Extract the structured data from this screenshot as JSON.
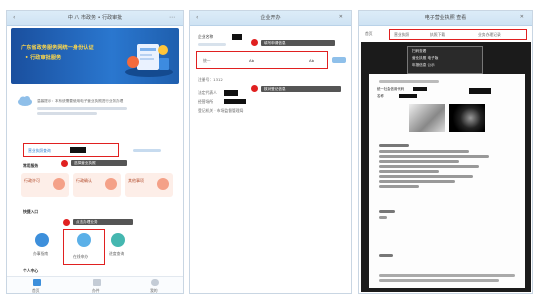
{
  "left_panel": {
    "title": "中 八 市政务 • 行政审批",
    "banner_title_line1": "广东省政务服务网统一身份认证",
    "banner_title_line2": "• 行政审批服务",
    "notice_text": "温馨提示：本系统需要使用电子营业执照进行业务办理",
    "search_label": "营业执照查询",
    "tooltip_1": "选择营业执照",
    "section_label_1": "常用服务",
    "service_1": "行政许可",
    "service_2": "行政确认",
    "service_3": "其他事项",
    "section_label_2": "快捷入口",
    "tooltip_2": "点击办理业务",
    "quick_1": "办事指南",
    "quick_2": "在线申办",
    "quick_3": "进度查询",
    "section_label_3": "个人中心",
    "nav_1": "首页",
    "nav_2": "办件",
    "nav_3": "我的"
  },
  "middle_panel": {
    "title": "企业开办",
    "field_1_label": "企业名称",
    "callout_1": "填写申请信息",
    "input_prefix": "统一",
    "input_mid": "Ab",
    "input_suffix": "Ab",
    "info_line_1": "注册号：1312",
    "callout_2": "核对登记信息",
    "info_line_2": "法定代表人",
    "info_line_3": "经营场所",
    "info_line_4": "登记机关 · 市场监督管理局"
  },
  "right_panel": {
    "title": "电子营业执照 查看",
    "tabs": [
      "首页",
      "营业执照",
      "执照下载",
      "业务办理记录"
    ],
    "notice_lines": [
      "扫码查看",
      "营业执照 电子版",
      "年报信息 公示"
    ],
    "doc_text_1": "统一社会信用代码",
    "doc_text_2": "名称"
  },
  "colors": {
    "highlight": "#e02020",
    "banner": "#1c5fb4",
    "accent": "#2f80d1"
  }
}
